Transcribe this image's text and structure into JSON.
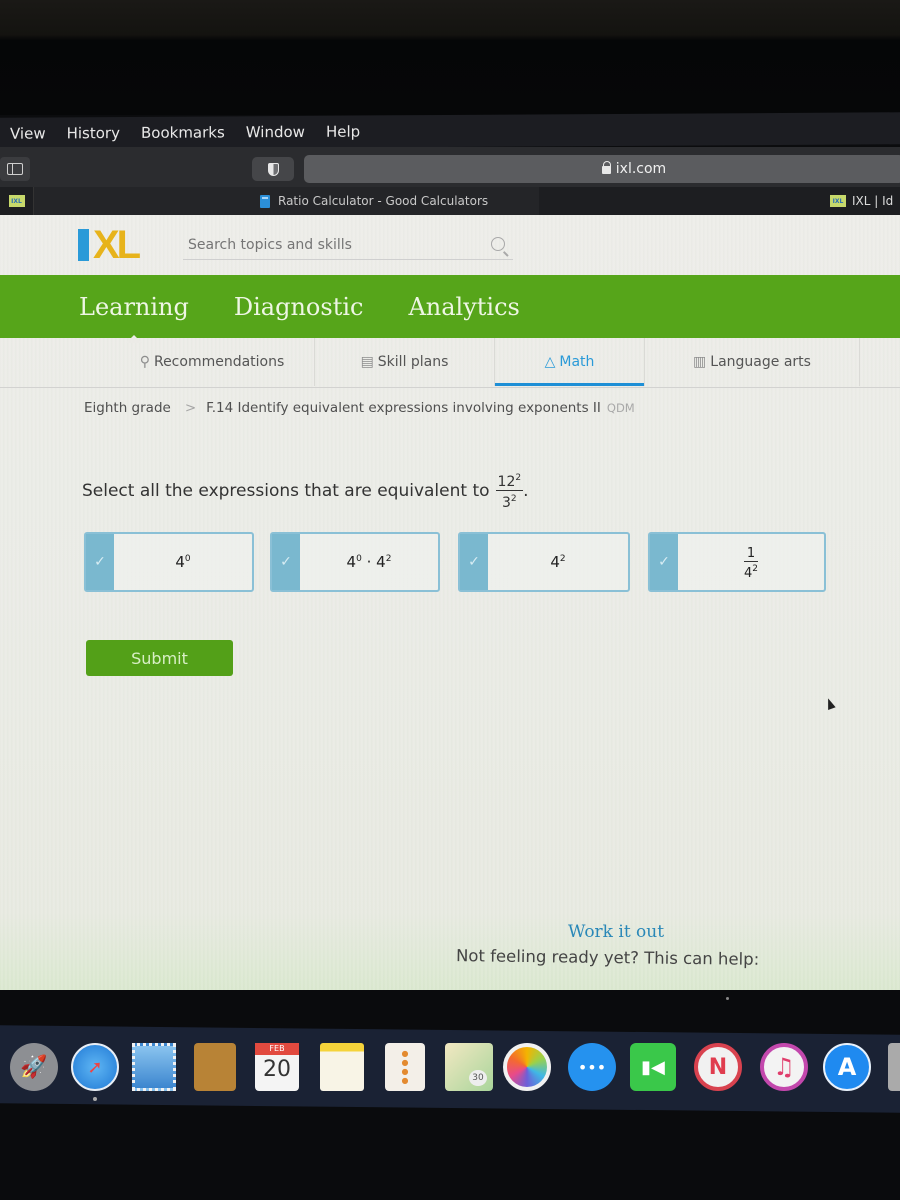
{
  "menubar": {
    "items": [
      "View",
      "History",
      "Bookmarks",
      "Window",
      "Help"
    ]
  },
  "toolbar": {
    "url": "ixl.com"
  },
  "tabs": {
    "active_title": "Ratio Calculator - Good Calculators",
    "right_title": "IXL | Id"
  },
  "ixl": {
    "logo_text": "XL",
    "search_placeholder": "Search topics and skills",
    "nav": [
      "Learning",
      "Diagnostic",
      "Analytics"
    ],
    "subnav": [
      {
        "label": "Recommendations",
        "icon": "recommendations-icon",
        "glyph": "⚲"
      },
      {
        "label": "Skill plans",
        "icon": "skill-plans-icon",
        "glyph": "▤"
      },
      {
        "label": "Math",
        "icon": "math-pyramid-icon",
        "glyph": "△"
      },
      {
        "label": "Language arts",
        "icon": "book-icon",
        "glyph": "▥"
      }
    ],
    "breadcrumb": {
      "grade": "Eighth grade",
      "separator": ">",
      "skill": "F.14 Identify equivalent expressions involving exponents II",
      "code": "QDM"
    },
    "question": {
      "prompt": "Select all the expressions that are equivalent to",
      "frac_num_base": "12",
      "frac_num_exp": "2",
      "frac_den_base": "3",
      "frac_den_exp": "2",
      "end": "."
    },
    "choices": [
      {
        "base": "4",
        "exp": "0",
        "selected": true
      },
      {
        "a_base": "4",
        "a_exp": "0",
        "op": "·",
        "b_base": "4",
        "b_exp": "2",
        "selected": true
      },
      {
        "base": "4",
        "exp": "2",
        "selected": true
      },
      {
        "num": "1",
        "den_base": "4",
        "den_exp": "2",
        "selected": true
      }
    ],
    "check_glyph": "✓",
    "submit_label": "Submit",
    "work_title": "Work it out",
    "work_subtitle": "Not feeling ready yet? This can help:"
  },
  "dock": {
    "apps": [
      "Launchpad",
      "Safari",
      "Mail",
      "Contacts",
      "Calendar",
      "Notes",
      "Reminders",
      "Maps",
      "Photos",
      "Messages",
      "FaceTime",
      "News",
      "Music",
      "App Store"
    ],
    "calendar_month": "FEB",
    "calendar_day": "20",
    "maps_badge": "30"
  }
}
